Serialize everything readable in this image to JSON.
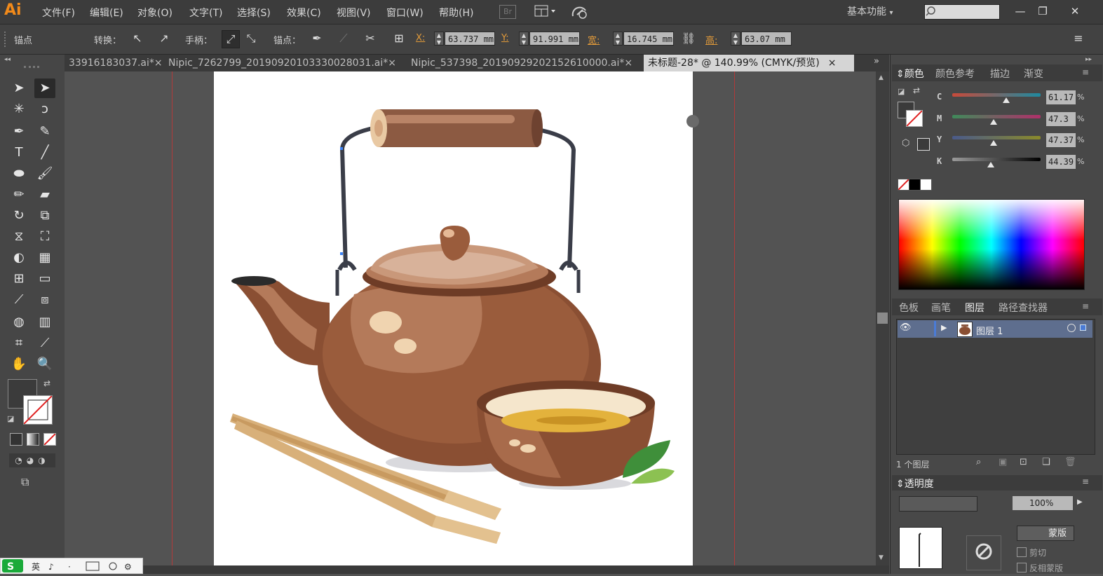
{
  "app": {
    "logo": "Ai"
  },
  "menu": [
    "文件(F)",
    "编辑(E)",
    "对象(O)",
    "文字(T)",
    "选择(S)",
    "效果(C)",
    "视图(V)",
    "窗口(W)",
    "帮助(H)"
  ],
  "menu_extras": {
    "br_badge": "Br",
    "workspace": "基本功能"
  },
  "window_controls": {
    "minimize": "—",
    "restore": "❐",
    "close": "✕"
  },
  "control_bar": {
    "anchor_panel": "锚点",
    "convert_label": "转换：",
    "handle_label": "手柄：",
    "anchor_label": "锚点：",
    "x_label": "X:",
    "x_value": "63.737 mm",
    "y_label": "Y:",
    "y_value": "91.991 mm",
    "w_label": "宽:",
    "w_value": "16.745 mm",
    "h_label": "高:",
    "h_value": "63.07 mm"
  },
  "tabs": [
    {
      "label": "33916183037.ai*",
      "close": "×"
    },
    {
      "label": "Nipic_7262799_20190920103330028031.ai*",
      "close": "×"
    },
    {
      "label": "Nipic_537398_20190929202152610000.ai*",
      "close": "×"
    },
    {
      "label": "未标题-28* @ 140.99% (CMYK/预览)",
      "close": "×",
      "active": true
    }
  ],
  "color_panel": {
    "tabs": [
      "颜色",
      "颜色参考",
      "描边",
      "渐变"
    ],
    "channels": [
      {
        "letter": "C",
        "value": "61.17",
        "level": 0.61
      },
      {
        "letter": "M",
        "value": "47.3",
        "level": 0.47
      },
      {
        "letter": "Y",
        "value": "47.37",
        "level": 0.47
      },
      {
        "letter": "K",
        "value": "44.39",
        "level": 0.44
      }
    ],
    "pct": "%"
  },
  "layers_panel": {
    "tabs": [
      "色板",
      "画笔",
      "图层",
      "路径查找器"
    ],
    "layer_name": "图层 1",
    "count_label": "1 个图层"
  },
  "transparency_panel": {
    "title": "透明度",
    "opacity": "100%",
    "mask_button": "蒙版",
    "clip_label": "剪切",
    "invert_label": "反相蒙版"
  },
  "colors": {
    "menubar": "#3c3c3c",
    "accent_orange": "#e29b3a",
    "guide_red": "#b13a3a",
    "pot_main": "#8a4f33",
    "pot_light": "#b47a5a",
    "handle_wire": "#3a3d48",
    "wood": "#8c5a42",
    "chopstick": "#d8b07a",
    "tea": "#e3b23c",
    "leaf": "#5aa843"
  }
}
